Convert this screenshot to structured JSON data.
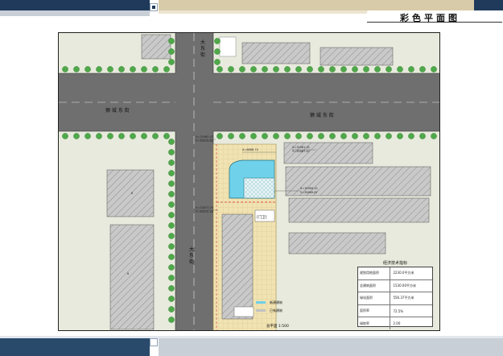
{
  "header": {
    "title": "彩色平面图"
  },
  "plan": {
    "road_horizontal_label_left": "狮 城 东 街",
    "road_horizontal_label_right": "狮 城 东 街",
    "road_vertical_label": "大 东 街",
    "road_vertical_label_lower": "大 东 街",
    "legend": [
      {
        "label": "新建建筑",
        "color": "#6fd2ea"
      },
      {
        "label": "已有建筑",
        "color": "#c2c2c2"
      }
    ],
    "scale_label": "总平面 1:500",
    "gate_label": "[门卫]"
  },
  "tech_table": {
    "title": "经济技术指标",
    "rows": [
      {
        "name": "规划用地面积",
        "value": "2230.0平方米"
      },
      {
        "name": "总建筑面积",
        "value": "1530.00平方米"
      },
      {
        "name": "绿化面积",
        "value": "556.37平方米"
      },
      {
        "name": "容积率",
        "value": "72.5%"
      },
      {
        "name": "绿地率",
        "value": "2.00"
      }
    ]
  },
  "colors": {
    "road": "#6f6f6f",
    "tree": "#4fa84a",
    "site_paving": "#f0e2b0",
    "new_building": "#6fd2ea",
    "existing_building": "#c2c2c2",
    "header_dark": "#1f3a5a",
    "header_tan": "#d8cba9"
  }
}
